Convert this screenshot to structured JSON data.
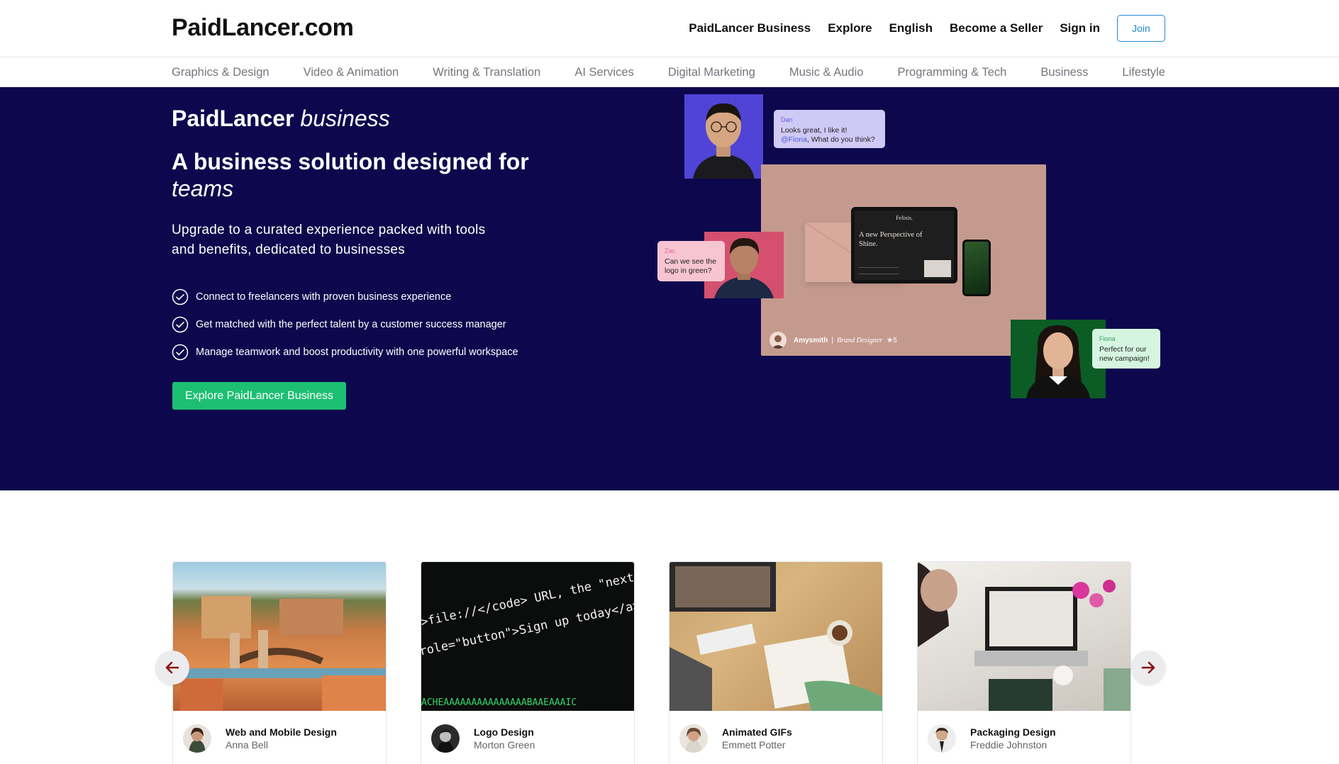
{
  "header": {
    "logo": "PaidLancer.com",
    "nav": [
      "PaidLancer Business",
      "Explore",
      "English",
      "Become a Seller",
      "Sign in"
    ],
    "join_label": "Join"
  },
  "categories": [
    "Graphics & Design",
    "Video & Animation",
    "Writing & Translation",
    "AI Services",
    "Digital Marketing",
    "Music & Audio",
    "Programming & Tech",
    "Business",
    "Lifestyle"
  ],
  "hero": {
    "brand": "PaidLancer",
    "brand_suffix": "business",
    "title": "A business solution designed for",
    "title_italic": "teams",
    "subtitle": "Upgrade to a curated experience packed with tools and benefits, dedicated to businesses",
    "features": [
      "Connect to freelancers with proven business experience",
      "Get matched with the perfect talent by a customer success manager",
      "Manage teamwork and boost productivity with one powerful workspace"
    ],
    "cta_label": "Explore PaidLancer Business",
    "colors": {
      "background": "#0d084d",
      "cta": "#1dbf73"
    },
    "collage": {
      "bubble_dan": {
        "name": "Dan",
        "line1": "Looks great, I like it!",
        "mention": "@Fiona",
        "line2": ", What do you think?"
      },
      "bubble_zac": {
        "name": "Zac",
        "text": "Can we see the logo in green?"
      },
      "bubble_fiona": {
        "name": "Fiona",
        "text": "Perfect for our new campaign!"
      },
      "tablet_brand": "Felixis.",
      "tablet_headline": "A new Perspective of Shine.",
      "designer_name": "Amysmith",
      "designer_role": "Brand Designer",
      "designer_rating": "★5"
    }
  },
  "cards": [
    {
      "title": "Web and Mobile Design",
      "author": "Anna Bell"
    },
    {
      "title": "Logo Design",
      "author": "Morton Green"
    },
    {
      "title": "Animated GIFs",
      "author": "Emmett Potter"
    },
    {
      "title": "Packaging Design",
      "author": "Freddie Johnston"
    }
  ],
  "code_image": {
    "line1": "e>file://</code> URL, the \"next\"",
    "line2": "role=\"button\">Sign up today</a></p",
    "line3": "ACHEAAAAAAAAAAAAAAABAAEAAAIC"
  },
  "icons": {
    "check": "check-circle-icon",
    "prev": "arrow-left-icon",
    "next": "arrow-right-icon"
  }
}
